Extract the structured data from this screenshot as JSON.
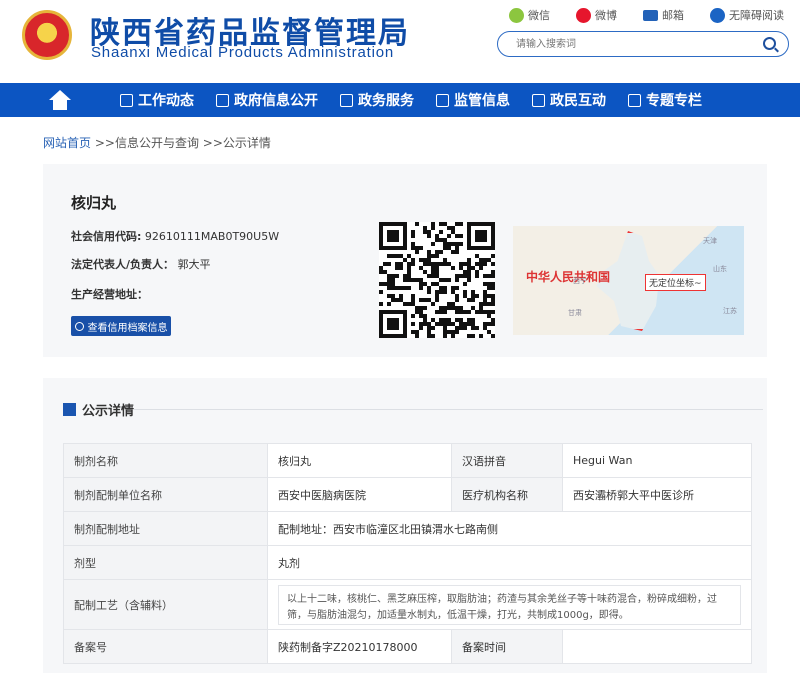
{
  "header": {
    "title_cn": "陕西省药品监督管理局",
    "title_en": "Shaanxi Medical Products Administration",
    "quick_links": [
      {
        "label": "微信",
        "icon": "wechat-icon"
      },
      {
        "label": "微博",
        "icon": "weibo-icon"
      },
      {
        "label": "邮箱",
        "icon": "mail-icon"
      },
      {
        "label": "无障碍阅读",
        "icon": "accessibility-icon"
      }
    ],
    "search_placeholder": "请输入搜索词"
  },
  "nav": {
    "items": [
      "工作动态",
      "政府信息公开",
      "政务服务",
      "监管信息",
      "政民互动",
      "专题专栏"
    ]
  },
  "breadcrumb": {
    "home": "网站首页",
    "sep1": " >>",
    "level1": "信息公开与查询",
    "sep2": " >>",
    "level2": "公示详情"
  },
  "entity": {
    "name": "核归丸",
    "credit_code_label": "社会信用代码:",
    "credit_code": "92610111MAB0T90U5W",
    "legal_rep_label": "法定代表人/负责人：",
    "legal_rep": "郭大平",
    "address_label": "生产经营地址：",
    "address": "",
    "credit_button": "查看信用档案信息"
  },
  "map": {
    "country_label": "中华人民共和国",
    "tip": "无定位坐标~",
    "labels": [
      "天津",
      "山东",
      "江苏",
      "西宁",
      "甘肃"
    ]
  },
  "details": {
    "section_title": "公示详情",
    "rows": [
      {
        "k1": "制剂名称",
        "v1": "核归丸",
        "k2": "汉语拼音",
        "v2": "Hegui Wan"
      },
      {
        "k1": "制剂配制单位名称",
        "v1": "西安中医脑病医院",
        "k2": "医疗机构名称",
        "v2": "西安灞桥郭大平中医诊所"
      },
      {
        "k1": "制剂配制地址",
        "v1": "配制地址：西安市临潼区北田镇渭水七路南侧"
      },
      {
        "k1": "剂型",
        "v1": "丸剂"
      },
      {
        "k1": "配制工艺（含辅料）",
        "v1": "以上十二味，核桃仁、黑芝麻压榨，取脂肪油；药渣与其余羌丝子等十味药混合，粉碎成细粉，过筛，与脂肪油混匀，加适量水制丸，低温干燥，打光，共制成1000g，即得。"
      },
      {
        "k1": "备案号",
        "v1": "陕药制备字Z20210178000",
        "k2": "备案时间",
        "v2": ""
      }
    ]
  },
  "colors": {
    "brand": "#0c55c2",
    "title": "#0f4ca7"
  }
}
